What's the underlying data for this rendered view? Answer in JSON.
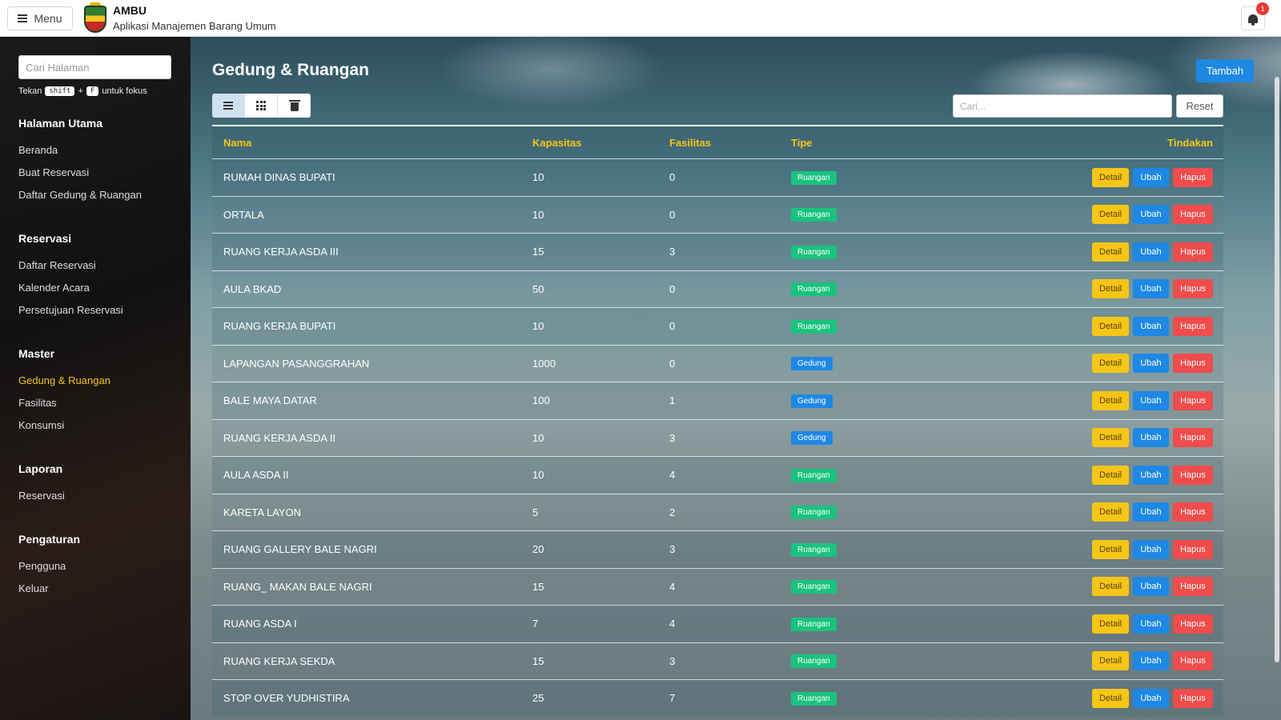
{
  "header": {
    "menu_label": "Menu",
    "app_name": "AMBU",
    "app_subtitle": "Aplikasi Manajemen Barang Umum",
    "notification_count": "1"
  },
  "sidebar": {
    "search_placeholder": "Cari Halaman",
    "hint_prefix": "Tekan",
    "hint_key1": "shift",
    "hint_plus": "+",
    "hint_key2": "F",
    "hint_suffix": "untuk fokus",
    "sections": [
      {
        "title": "Halaman Utama",
        "items": [
          "Beranda",
          "Buat Reservasi",
          "Daftar Gedung & Ruangan"
        ]
      },
      {
        "title": "Reservasi",
        "items": [
          "Daftar Reservasi",
          "Kalender Acara",
          "Persetujuan Reservasi"
        ]
      },
      {
        "title": "Master",
        "items": [
          "Gedung & Ruangan",
          "Fasilitas",
          "Konsumsi"
        ]
      },
      {
        "title": "Laporan",
        "items": [
          "Reservasi"
        ]
      },
      {
        "title": "Pengaturan",
        "items": [
          "Pengguna",
          "Keluar"
        ]
      }
    ]
  },
  "main": {
    "title": "Gedung & Ruangan",
    "add_label": "Tambah",
    "search_placeholder": "Cari...",
    "reset_label": "Reset",
    "columns": {
      "nama": "Nama",
      "kapasitas": "Kapasitas",
      "fasilitas": "Fasilitas",
      "tipe": "Tipe",
      "tindakan": "Tindakan"
    },
    "actions": {
      "detail": "Detail",
      "ubah": "Ubah",
      "hapus": "Hapus"
    },
    "rows": [
      {
        "nama": "RUMAH DINAS BUPATI",
        "kapasitas": "10",
        "fasilitas": "0",
        "tipe": "Ruangan"
      },
      {
        "nama": "ORTALA",
        "kapasitas": "10",
        "fasilitas": "0",
        "tipe": "Ruangan"
      },
      {
        "nama": "RUANG KERJA ASDA III",
        "kapasitas": "15",
        "fasilitas": "3",
        "tipe": "Ruangan"
      },
      {
        "nama": "AULA BKAD",
        "kapasitas": "50",
        "fasilitas": "0",
        "tipe": "Ruangan"
      },
      {
        "nama": "RUANG KERJA BUPATI",
        "kapasitas": "10",
        "fasilitas": "0",
        "tipe": "Ruangan"
      },
      {
        "nama": "LAPANGAN PASANGGRAHAN",
        "kapasitas": "1000",
        "fasilitas": "0",
        "tipe": "Gedung"
      },
      {
        "nama": "BALE MAYA DATAR",
        "kapasitas": "100",
        "fasilitas": "1",
        "tipe": "Gedung"
      },
      {
        "nama": "RUANG KERJA ASDA II",
        "kapasitas": "10",
        "fasilitas": "3",
        "tipe": "Gedung"
      },
      {
        "nama": "AULA ASDA II",
        "kapasitas": "10",
        "fasilitas": "4",
        "tipe": "Ruangan"
      },
      {
        "nama": "KARETA LAYON",
        "kapasitas": "5",
        "fasilitas": "2",
        "tipe": "Ruangan"
      },
      {
        "nama": "RUANG GALLERY BALE NAGRI",
        "kapasitas": "20",
        "fasilitas": "3",
        "tipe": "Ruangan"
      },
      {
        "nama": "RUANG_ MAKAN BALE NAGRI",
        "kapasitas": "15",
        "fasilitas": "4",
        "tipe": "Ruangan"
      },
      {
        "nama": "RUANG ASDA I",
        "kapasitas": "7",
        "fasilitas": "4",
        "tipe": "Ruangan"
      },
      {
        "nama": "RUANG KERJA SEKDA",
        "kapasitas": "15",
        "fasilitas": "3",
        "tipe": "Ruangan"
      },
      {
        "nama": "STOP OVER YUDHISTIRA",
        "kapasitas": "25",
        "fasilitas": "7",
        "tipe": "Ruangan"
      }
    ]
  },
  "colors": {
    "accent_yellow": "#f5c518",
    "primary_blue": "#1e88e5",
    "danger_red": "#ef4c4c",
    "success_green": "#19c37d"
  }
}
